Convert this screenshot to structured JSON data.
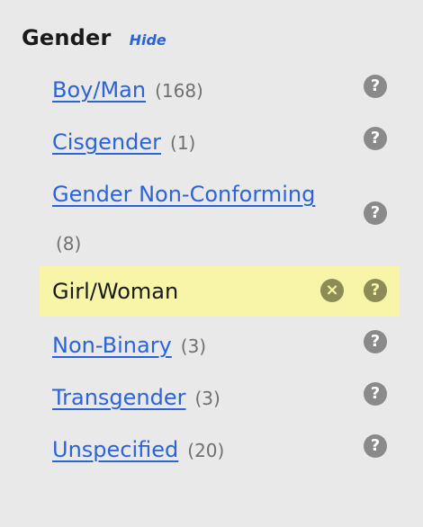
{
  "filter": {
    "title": "Gender",
    "hide_label": "Hide",
    "help_glyph": "?",
    "clear_glyph": "×",
    "items": [
      {
        "label": "Boy/Man",
        "count": "(168)"
      },
      {
        "label": "Cisgender",
        "count": "(1)"
      },
      {
        "label": "Gender Non-Conforming",
        "count": "(8)"
      },
      {
        "label": "Girl/Woman",
        "count": "",
        "selected": true
      },
      {
        "label": "Non-Binary",
        "count": "(3)"
      },
      {
        "label": "Transgender",
        "count": "(3)"
      },
      {
        "label": "Unspecified",
        "count": "(20)"
      }
    ]
  },
  "colors": {
    "background": "#e9e9e9",
    "link": "#2b63d9",
    "selected_bg": "#f8f4a8",
    "help_icon": "#8a8a8a",
    "selected_icon": "#8d8c57",
    "count_text": "#707070"
  }
}
